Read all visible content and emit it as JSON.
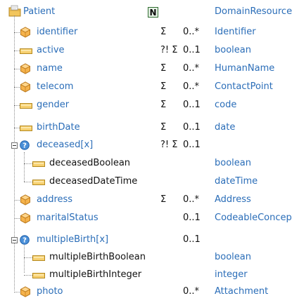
{
  "root": {
    "name": "Patient",
    "flag": "N",
    "type": "DomainResource",
    "icon": "folder-icon"
  },
  "rows": [
    {
      "name": "identifier",
      "flags": "Σ",
      "card": "0..*",
      "type": "Identifier",
      "icon": "datatype-icon"
    },
    {
      "name": "active",
      "flags": "?! Σ",
      "card": "0..1",
      "type": "boolean",
      "icon": "primitive-icon"
    },
    {
      "name": "name",
      "flags": "Σ",
      "card": "0..*",
      "type": "HumanName",
      "icon": "datatype-icon"
    },
    {
      "name": "telecom",
      "flags": "Σ",
      "card": "0..*",
      "type": "ContactPoint",
      "icon": "datatype-icon"
    },
    {
      "name": "gender",
      "flags": "Σ",
      "card": "0..1",
      "type": "code",
      "icon": "primitive-icon"
    },
    {
      "name": "birthDate",
      "flags": "Σ",
      "card": "0..1",
      "type": "date",
      "icon": "primitive-icon"
    },
    {
      "name": "deceased[x]",
      "flags": "?! Σ",
      "card": "0..1",
      "type": "",
      "icon": "choice-icon"
    },
    {
      "name": "deceasedBoolean",
      "flags": "",
      "card": "",
      "type": "boolean",
      "icon": "primitive-icon"
    },
    {
      "name": "deceasedDateTime",
      "flags": "",
      "card": "",
      "type": "dateTime",
      "icon": "primitive-icon"
    },
    {
      "name": "address",
      "flags": "Σ",
      "card": "0..*",
      "type": "Address",
      "icon": "datatype-icon"
    },
    {
      "name": "maritalStatus",
      "flags": "",
      "card": "0..1",
      "type": "CodeableConcept",
      "icon": "datatype-icon"
    },
    {
      "name": "multipleBirth[x]",
      "flags": "",
      "card": "0..1",
      "type": "",
      "icon": "choice-icon"
    },
    {
      "name": "multipleBirthBoolean",
      "flags": "",
      "card": "",
      "type": "boolean",
      "icon": "primitive-icon"
    },
    {
      "name": "multipleBirthInteger",
      "flags": "",
      "card": "",
      "type": "integer",
      "icon": "primitive-icon"
    },
    {
      "name": "photo",
      "flags": "",
      "card": "0..*",
      "type": "Attachment",
      "icon": "datatype-icon"
    }
  ]
}
